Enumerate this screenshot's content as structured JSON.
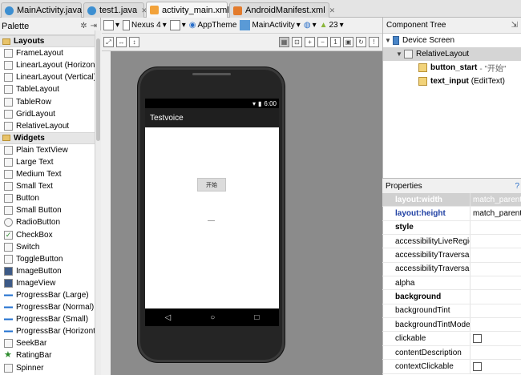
{
  "tabs": [
    {
      "label": "MainActivity.java",
      "icon": "java-class-icon",
      "active": false
    },
    {
      "label": "test1.java",
      "icon": "java-class-icon",
      "active": false
    },
    {
      "label": "activity_main.xml",
      "icon": "xml-layout-icon",
      "active": true
    },
    {
      "label": "AndroidManifest.xml",
      "icon": "manifest-icon",
      "active": false
    }
  ],
  "palette": {
    "title": "Palette",
    "layouts_header": "Layouts",
    "layouts": [
      "FrameLayout",
      "LinearLayout (Horizonta",
      "LinearLayout (Vertical)",
      "TableLayout",
      "TableRow",
      "GridLayout",
      "RelativeLayout"
    ],
    "widgets_header": "Widgets",
    "widgets": [
      "Plain TextView",
      "Large Text",
      "Medium Text",
      "Small Text",
      "Button",
      "Small Button",
      "RadioButton",
      "CheckBox",
      "Switch",
      "ToggleButton",
      "ImageButton",
      "ImageView",
      "ProgressBar (Large)",
      "ProgressBar (Normal)",
      "ProgressBar (Small)",
      "ProgressBar (Horizonta",
      "SeekBar",
      "RatingBar",
      "Spinner"
    ]
  },
  "toolbar": {
    "device": "Nexus 4",
    "theme": "AppTheme",
    "activity": "MainActivity",
    "api": "23"
  },
  "preview": {
    "time": "6:00",
    "app_title": "Testvoice",
    "button_text": "开始"
  },
  "component_tree": {
    "title": "Component Tree",
    "root": "Device Screen",
    "layout": "RelativeLayout",
    "children": [
      {
        "id": "button_start",
        "detail": "- \"开始\""
      },
      {
        "id": "text_input",
        "detail": "(EditText)"
      }
    ]
  },
  "properties": {
    "title": "Properties",
    "rows": [
      {
        "name": "layout:width",
        "value": "match_parent",
        "style": "selected"
      },
      {
        "name": "layout:height",
        "value": "match_parent",
        "style": "blue"
      },
      {
        "name": "style",
        "value": "",
        "style": "bold"
      },
      {
        "name": "accessibilityLiveRegion",
        "value": "",
        "style": "normal"
      },
      {
        "name": "accessibilityTraversalAfter",
        "value": "",
        "style": "normal"
      },
      {
        "name": "accessibilityTraversalBefore",
        "value": "",
        "style": "normal"
      },
      {
        "name": "alpha",
        "value": "",
        "style": "normal"
      },
      {
        "name": "background",
        "value": "",
        "style": "bold"
      },
      {
        "name": "backgroundTint",
        "value": "",
        "style": "normal"
      },
      {
        "name": "backgroundTintMode",
        "value": "",
        "style": "normal"
      },
      {
        "name": "clickable",
        "value": "",
        "style": "checkbox"
      },
      {
        "name": "contentDescription",
        "value": "",
        "style": "normal"
      },
      {
        "name": "contextClickable",
        "value": "",
        "style": "checkbox"
      }
    ]
  }
}
